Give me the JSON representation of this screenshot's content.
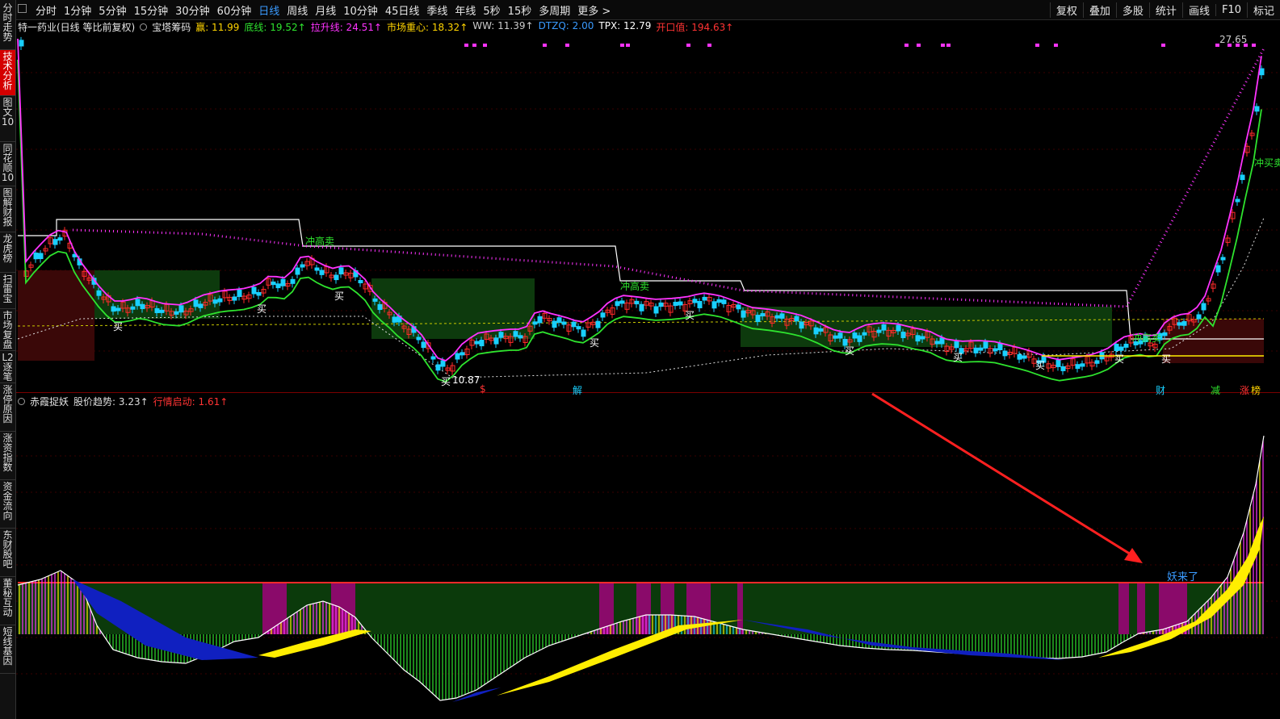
{
  "toolbar": {
    "tabs": [
      "分时",
      "1分钟",
      "5分钟",
      "15分钟",
      "30分钟",
      "60分钟",
      "日线",
      "周线",
      "月线",
      "10分钟",
      "45日线",
      "季线",
      "年线",
      "5秒",
      "15秒",
      "多周期",
      "更多 >"
    ],
    "active_tab": "日线",
    "right_tools": [
      "复权",
      "叠加",
      "多股",
      "统计",
      "画线",
      "F10",
      "标记"
    ]
  },
  "sidebar": {
    "items": [
      "分时走势",
      "技术分析",
      "图文10",
      "同花顺10",
      "图解财报",
      "龙虎榜",
      "扫雷宝",
      "市场复盘",
      "L2逐笔",
      "涨停原因",
      "涨资指数",
      "资金流向",
      "东财股吧",
      "董秘互动",
      "短线基因"
    ],
    "active": "技术分析"
  },
  "main_indicator": {
    "stock": "特一药业(日线 等比前复权)",
    "name": "宝塔筹码",
    "fields": [
      {
        "label": "赢:",
        "value": "11.99",
        "color": "#ffd400"
      },
      {
        "label": "底线:",
        "value": "19.52↑",
        "color": "#2ee32e"
      },
      {
        "label": "拉升线:",
        "value": "24.51↑",
        "color": "#ff33ff"
      },
      {
        "label": "市场重心:",
        "value": "18.32↑",
        "color": "#ffd400"
      },
      {
        "label": "WW:",
        "value": "11.39↑",
        "color": "#cccccc"
      },
      {
        "label": "DTZQ:",
        "value": "2.00",
        "color": "#3a9bff"
      },
      {
        "label": "TPX:",
        "value": "12.79",
        "color": "#ffffff"
      },
      {
        "label": "开口值:",
        "value": "194.63↑",
        "color": "#ff3333"
      }
    ]
  },
  "chart_labels": {
    "high_price": "27.65",
    "low_price": "10.87",
    "buy": "买",
    "sell": "冲高卖",
    "sell2": "冲高卖",
    "sell3": "冲买卖",
    "markers": [
      "$",
      "解",
      "财",
      "减",
      "涨",
      "榜"
    ]
  },
  "sub_indicator": {
    "name": "赤霞捉妖",
    "fields": [
      {
        "label": "股价趋势:",
        "value": "3.23↑",
        "color": "#dddddd"
      },
      {
        "label": "行情启动:",
        "value": "1.61↑",
        "color": "#ff3333"
      }
    ],
    "signal": "妖来了"
  },
  "colors": {
    "up": "#ff2a2a",
    "down": "#19d0ff",
    "green": "#2ee32e",
    "magenta": "#ff33ff",
    "yellow": "#ffee00",
    "darkgreen": "#0d3a0d",
    "blue": "#1020c0"
  }
}
